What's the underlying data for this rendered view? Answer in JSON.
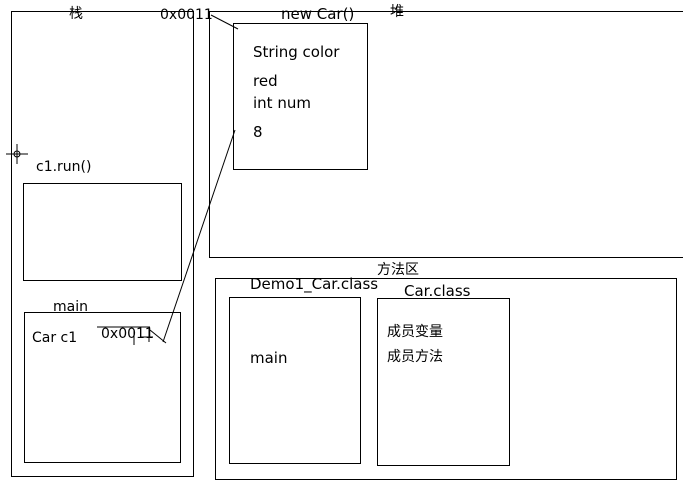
{
  "stack": {
    "title": "栈",
    "run_frame": {
      "label": "c1.run()"
    },
    "main_frame": {
      "label": "main",
      "var": "Car c1",
      "ref": "0x0011"
    }
  },
  "heap": {
    "title": "堆",
    "object": {
      "label": "new Car()",
      "address": "0x0011",
      "field1_name": "String color",
      "field1_value": "red",
      "field2_name": "int num",
      "field2_value": "8"
    }
  },
  "method_area": {
    "title": "方法区",
    "demo_class": {
      "label": "Demo1_Car.class",
      "member": "main"
    },
    "car_class": {
      "label": "Car.class",
      "member1": "成员变量",
      "member2": "成员方法"
    }
  }
}
